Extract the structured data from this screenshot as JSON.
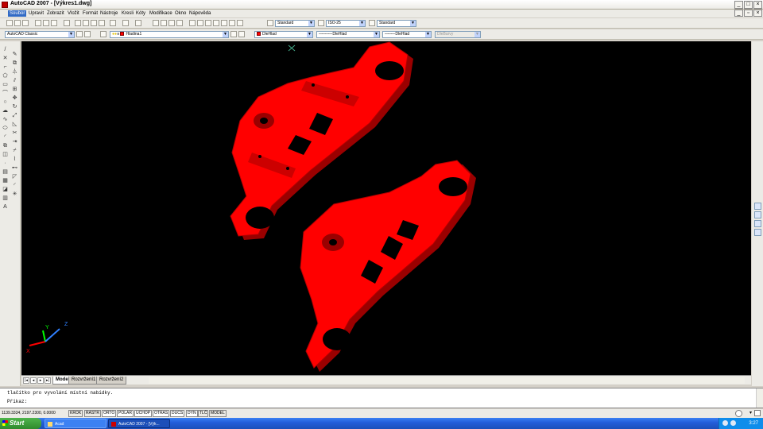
{
  "window": {
    "title": "AutoCAD 2007 - [Výkres1.dwg]"
  },
  "menus": [
    "Soubor",
    "Upravit",
    "Zobrazit",
    "Vložit",
    "Formát",
    "Nástroje",
    "Kresli",
    "Kóty",
    "Modifikace",
    "Okno",
    "Nápověda"
  ],
  "toolbar1": {
    "text_style": "Standard",
    "dim_style": "ISO-25",
    "table_style": "Standard"
  },
  "toolbar2": {
    "workspace": "AutoCAD Classic",
    "layer": "Hladina1",
    "color": "DleHlad",
    "linetype": "DleHlad",
    "lineweight": "DleHlad",
    "plotstyle": "DleBarvy"
  },
  "tabs": [
    "Model",
    "Rozvržení1",
    "Rozvržení2"
  ],
  "ucs_icon": {
    "x_label": "X",
    "y_label": "Y",
    "z_label": "Z"
  },
  "command_line": {
    "history": "tlačítko pro vyvolání místní nabídky.",
    "prompt": "Příkaz:"
  },
  "status": {
    "coords": "1139.3334, 2197.2300, 0.0000",
    "toggles": [
      "KROK",
      "RASTR",
      "ORTO",
      "POLAR",
      "UCHOP",
      "OTRAS",
      "DUCS",
      "DYN",
      "TLČ",
      "MODEL"
    ]
  },
  "taskbar": {
    "start_label": "Start",
    "tasks": [
      "Acad",
      "AutoCAD 2007 - [Výk..."
    ],
    "clock": "3:27"
  },
  "colors": {
    "part_red": "#ff0000",
    "part_shadow": "#9a0000",
    "canvas": "#000000"
  }
}
